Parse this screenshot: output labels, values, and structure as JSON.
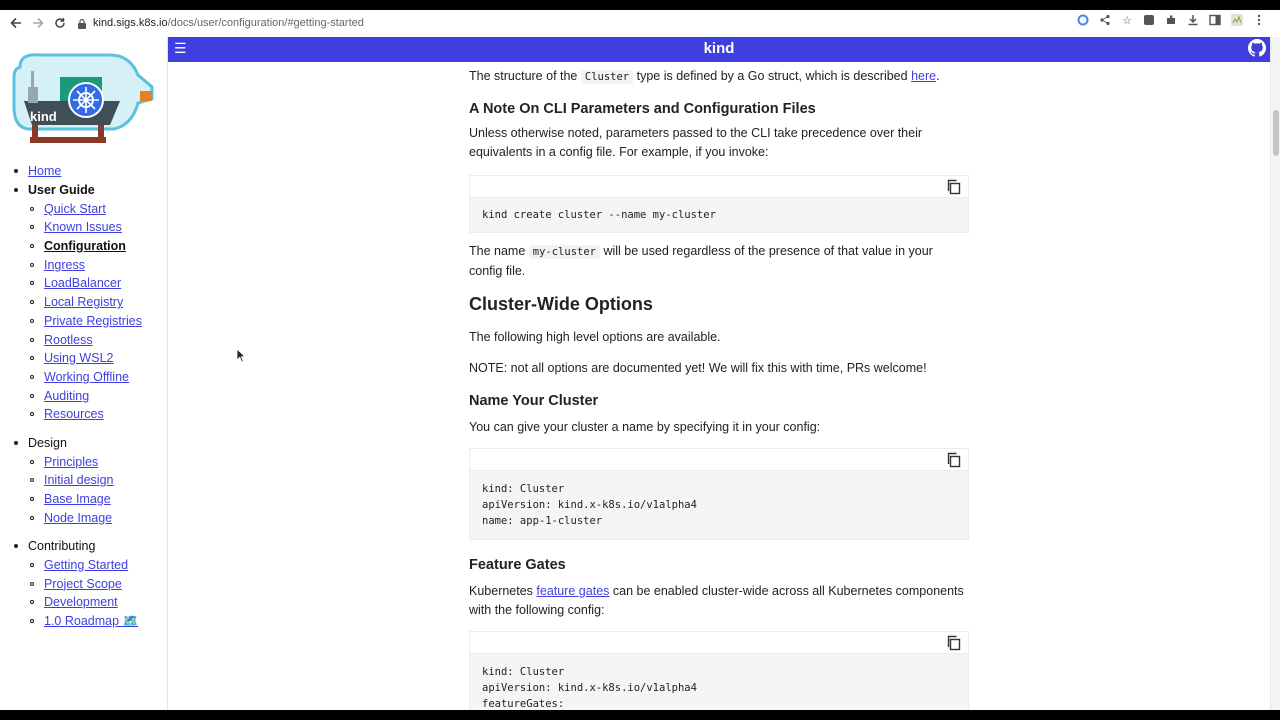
{
  "browser": {
    "url_host": "kind.sigs.k8s.io",
    "url_path": "/docs/user/configuration/#getting-started"
  },
  "header": {
    "title": "kind",
    "menu_icon": "hamburger-icon",
    "github_icon": "github-icon"
  },
  "colors": {
    "header_bg": "#3f3fe0",
    "link": "#3f3fe0"
  },
  "sidebar": {
    "logo_text": "kind",
    "groups": [
      {
        "title": "Home",
        "is_link": true,
        "items": []
      },
      {
        "title": "User Guide",
        "is_link": false,
        "items": [
          "Quick Start",
          "Known Issues",
          "Configuration",
          "Ingress",
          "LoadBalancer",
          "Local Registry",
          "Private Registries",
          "Rootless",
          "Using WSL2",
          "Working Offline",
          "Auditing",
          "Resources"
        ]
      },
      {
        "title": "Design",
        "is_link": false,
        "items": [
          "Principles",
          "Initial design",
          "Base Image",
          "Node Image"
        ]
      },
      {
        "title": "Contributing",
        "is_link": false,
        "items": [
          "Getting Started",
          "Project Scope",
          "Development",
          "1.0 Roadmap 🗺️"
        ]
      }
    ],
    "active_item": "Configuration"
  },
  "content": {
    "intro": {
      "pre": "The structure of the",
      "code": "Cluster",
      "mid": "type is defined by a Go struct, which is described",
      "link": "here",
      "post": "."
    },
    "cli_heading": "A Note On CLI Parameters and Configuration Files",
    "cli_para": "Unless otherwise noted, parameters passed to the CLI take precedence over their equivalents in a config file. For example, if you invoke:",
    "cli_code": "kind create cluster --name my-cluster",
    "name_para": {
      "pre": "The name",
      "code": "my-cluster",
      "post": "will be used regardless of the presence of that value in your config file."
    },
    "cluster_wide_heading": "Cluster-Wide Options",
    "cluster_wide_para": "The following high level options are available.",
    "note_para": "NOTE: not all options are documented yet! We will fix this with time, PRs welcome!",
    "name_heading": "Name Your Cluster",
    "name_intro": "You can give your cluster a name by specifying it in your config:",
    "name_code": "kind: Cluster\napiVersion: kind.x-k8s.io/v1alpha4\nname: app-1-cluster",
    "fg_heading": "Feature Gates",
    "fg_para": {
      "pre": "Kubernetes",
      "link": "feature gates",
      "post": "can be enabled cluster-wide across all Kubernetes components with the following config:"
    },
    "fg_code": "kind: Cluster\napiVersion: kind.x-k8s.io/v1alpha4\nfeatureGates:"
  }
}
